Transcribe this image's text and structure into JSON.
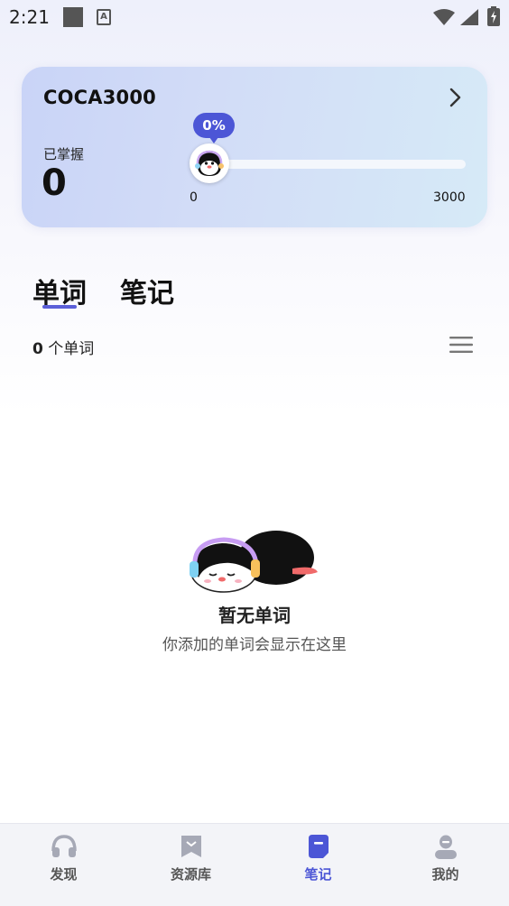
{
  "status_bar": {
    "time": "2:21"
  },
  "progress_card": {
    "title": "COCA3000",
    "mastered_label": "已掌握",
    "mastered_value": "0",
    "progress_percent_label": "0%",
    "progress_fraction": 0,
    "range_min": "0",
    "range_max": "3000"
  },
  "tabs": [
    {
      "label": "单词",
      "active": true
    },
    {
      "label": "笔记",
      "active": false
    }
  ],
  "word_list": {
    "count": "0",
    "count_suffix": " 个单词"
  },
  "empty_state": {
    "title": "暂无单词",
    "subtitle": "你添加的单词会显示在这里"
  },
  "bottom_nav": [
    {
      "label": "发现",
      "icon": "headphones-icon",
      "active": false
    },
    {
      "label": "资源库",
      "icon": "bookmark-icon",
      "active": false
    },
    {
      "label": "笔记",
      "icon": "note-icon",
      "active": true
    },
    {
      "label": "我的",
      "icon": "profile-icon",
      "active": false
    }
  ],
  "colors": {
    "accent": "#4c56d6",
    "inactive": "#a6a9b6"
  }
}
